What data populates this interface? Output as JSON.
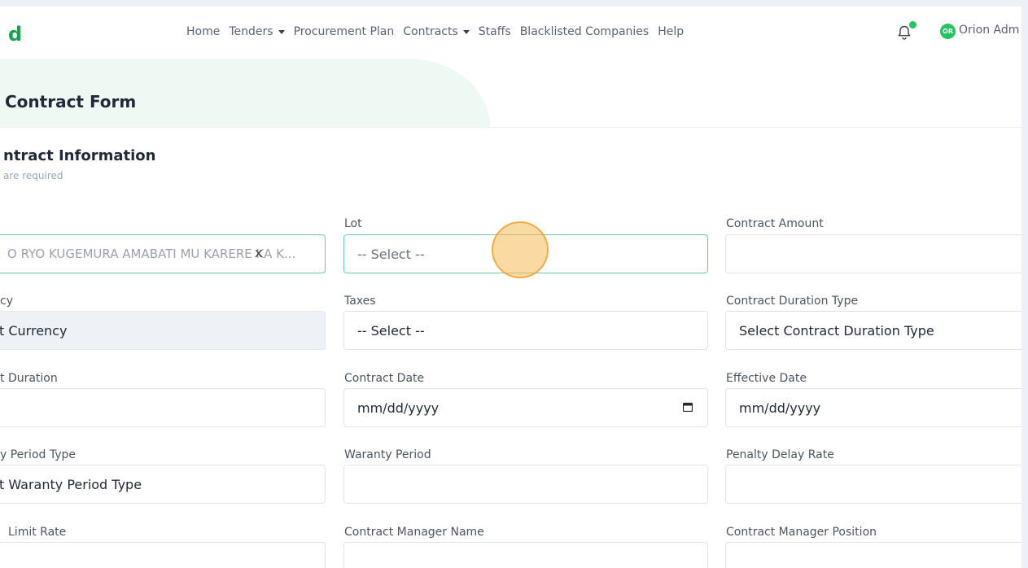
{
  "nav": {
    "logo": "d",
    "items": [
      {
        "label": "Home",
        "dropdown": false
      },
      {
        "label": "Tenders",
        "dropdown": true
      },
      {
        "label": "Procurement Plan",
        "dropdown": false
      },
      {
        "label": "Contracts",
        "dropdown": true
      },
      {
        "label": "Staffs",
        "dropdown": false
      },
      {
        "label": "Blacklisted Companies",
        "dropdown": false
      },
      {
        "label": "Help",
        "dropdown": false
      }
    ],
    "avatar_initials": "OR",
    "user_name": "Orion Adm"
  },
  "page": {
    "title": "Contract Form"
  },
  "section": {
    "title": "ntract Information",
    "subtitle": "are required"
  },
  "form": {
    "tender_value": "O RYO KUGEMURA AMABATI MU KARERE KA K...",
    "tender_clear": "x",
    "lot_label": "Lot",
    "lot_placeholder": "-- Select --",
    "amount_label": "Contract Amount",
    "currency_label": "cy",
    "currency_value": "t Currency",
    "taxes_label": "Taxes",
    "taxes_value": "-- Select --",
    "duration_type_label": "Contract Duration Type",
    "duration_type_value": "Select Contract Duration Type",
    "duration_label": "t Duration",
    "contract_date_label": "Contract Date",
    "contract_date_value": "mm/dd/yyyy",
    "effective_date_label": "Effective Date",
    "effective_date_value": "mm/dd/yyyy",
    "warranty_type_label": "y Period Type",
    "warranty_type_value": "t Waranty Period Type",
    "warranty_period_label": "Waranty Period",
    "penalty_label": "Penalty Delay Rate",
    "limit_rate_label": "Limit Rate",
    "manager_name_label": "Contract Manager Name",
    "manager_position_label": "Contract Manager Position"
  },
  "colors": {
    "brand": "#16a34a",
    "accent_border": "#6cc6b7",
    "click_marker": "#f6b956"
  }
}
